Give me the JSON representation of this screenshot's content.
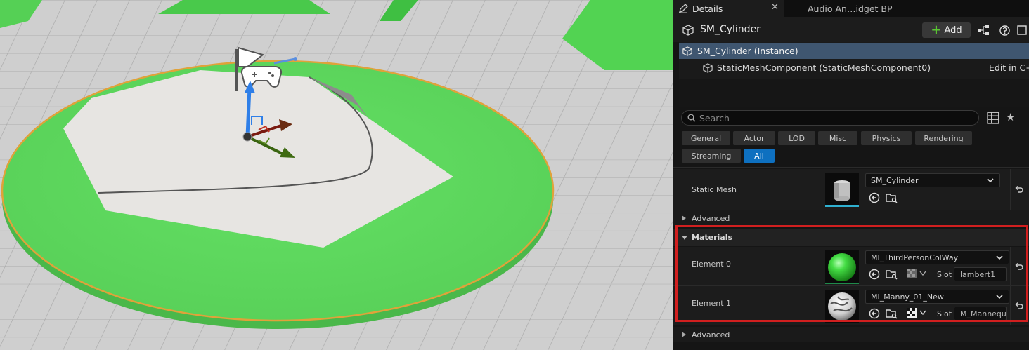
{
  "viewport": {
    "description_icons": [
      "flag-icon",
      "gamepad-icon",
      "transform-gizmo"
    ]
  },
  "details": {
    "tab_details": "Details",
    "tab_other": "Audio An…idget BP",
    "object_name": "SM_Cylinder",
    "add_label": "Add",
    "tree": {
      "instance": "SM_Cylinder (Instance)",
      "component": "StaticMeshComponent (StaticMeshComponent0)",
      "edit_cpp": "Edit in C++"
    },
    "search_placeholder": "Search",
    "filters": [
      "General",
      "Actor",
      "LOD",
      "Misc",
      "Physics",
      "Rendering",
      "Streaming",
      "All"
    ],
    "active_filter": "All",
    "static_mesh": {
      "label": "Static Mesh",
      "value": "SM_Cylinder"
    },
    "advanced_label": "Advanced",
    "materials": {
      "title": "Materials",
      "slot_label": "Slot",
      "elements": [
        {
          "label": "Element 0",
          "material": "MI_ThirdPersonColWay",
          "slot": "lambert1"
        },
        {
          "label": "Element 1",
          "material": "MI_Manny_01_New",
          "slot": "M_Mannequ"
        }
      ]
    },
    "advanced_label_2": "Advanced"
  },
  "colors": {
    "accent_blue": "#0e70c0",
    "selection_blue": "#3f5670",
    "highlight_red": "#d11f1f",
    "add_green": "#5ac832",
    "platform_green": "#5cdc5c"
  }
}
